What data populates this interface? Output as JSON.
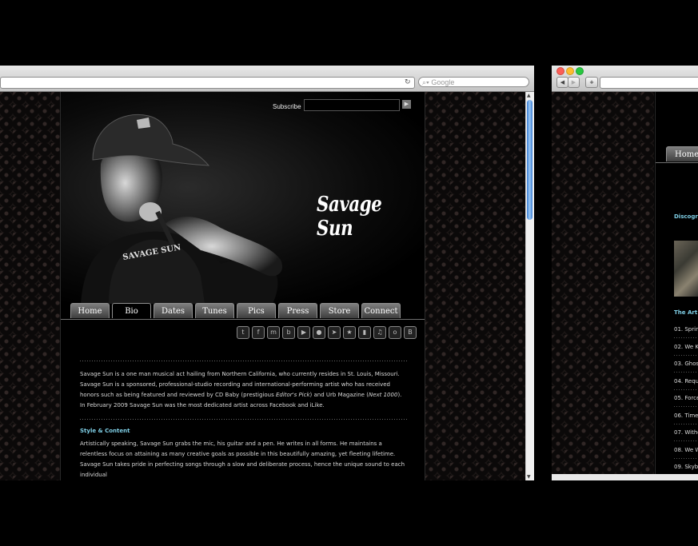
{
  "left_window": {
    "search_placeholder": "Google",
    "reload_icon": "↻",
    "page": {
      "subscribe_label": "Subscribe",
      "logo_text": "Savage Sun",
      "nav_tabs": [
        {
          "label": "Home",
          "active": false
        },
        {
          "label": "Bio",
          "active": true
        },
        {
          "label": "Dates",
          "active": false
        },
        {
          "label": "Tunes",
          "active": false
        },
        {
          "label": "Pics",
          "active": false
        },
        {
          "label": "Press",
          "active": false
        },
        {
          "label": "Store",
          "active": false
        },
        {
          "label": "Connect",
          "active": false
        }
      ],
      "social_icons": [
        "twitter-icon",
        "facebook-icon",
        "myspace-icon",
        "bebo-icon",
        "youtube-icon",
        "apple-icon",
        "reverbnation-icon",
        "star-icon",
        "chart-icon",
        "music-icon",
        "orkut-icon",
        "blogger-icon"
      ],
      "bio": {
        "paragraph_1a": "Savage Sun is a one man musical act hailing from Northern California, who currently resides in St. Louis, Missouri. Savage Sun is a sponsored, professional-studio recording and international-performing artist who has received honors such as being featured and reviewed by CD Baby (prestigious ",
        "paragraph_1_em1": "Editor's Pick",
        "paragraph_1b": ") and Urb Magazine (",
        "paragraph_1_em2": "Next 1000",
        "paragraph_1c": "). In February 2009 Savage Sun was the most dedicated artist across Facebook and iLike.",
        "section_heading": "Style & Content",
        "paragraph_2": "Artistically speaking, Savage Sun grabs the mic, his guitar and a pen. He writes in all forms. He maintains a relentless focus on attaining as many creative goals as possible in this beautifully amazing, yet fleeting lifetime. Savage Sun takes pride in perfecting songs through a slow and deliberate process, hence the unique sound to each individual"
      }
    }
  },
  "right_window": {
    "add_tab_label": "+",
    "home_tab": "Home",
    "discography_heading": "Discogr",
    "album_heading": "The Art o",
    "tracks": [
      "01. Sprin",
      "02. We K",
      "03. Ghos",
      "04. Requ",
      "05. Force",
      "06. Time",
      "07. Withe",
      "08. We W",
      "09. Skyb"
    ]
  },
  "colors": {
    "accent_heading": "#7fcfe6",
    "background": "#000000",
    "tab_gradient_top": "#7e7e7e",
    "scroll_thumb": "#3b7fd6"
  }
}
